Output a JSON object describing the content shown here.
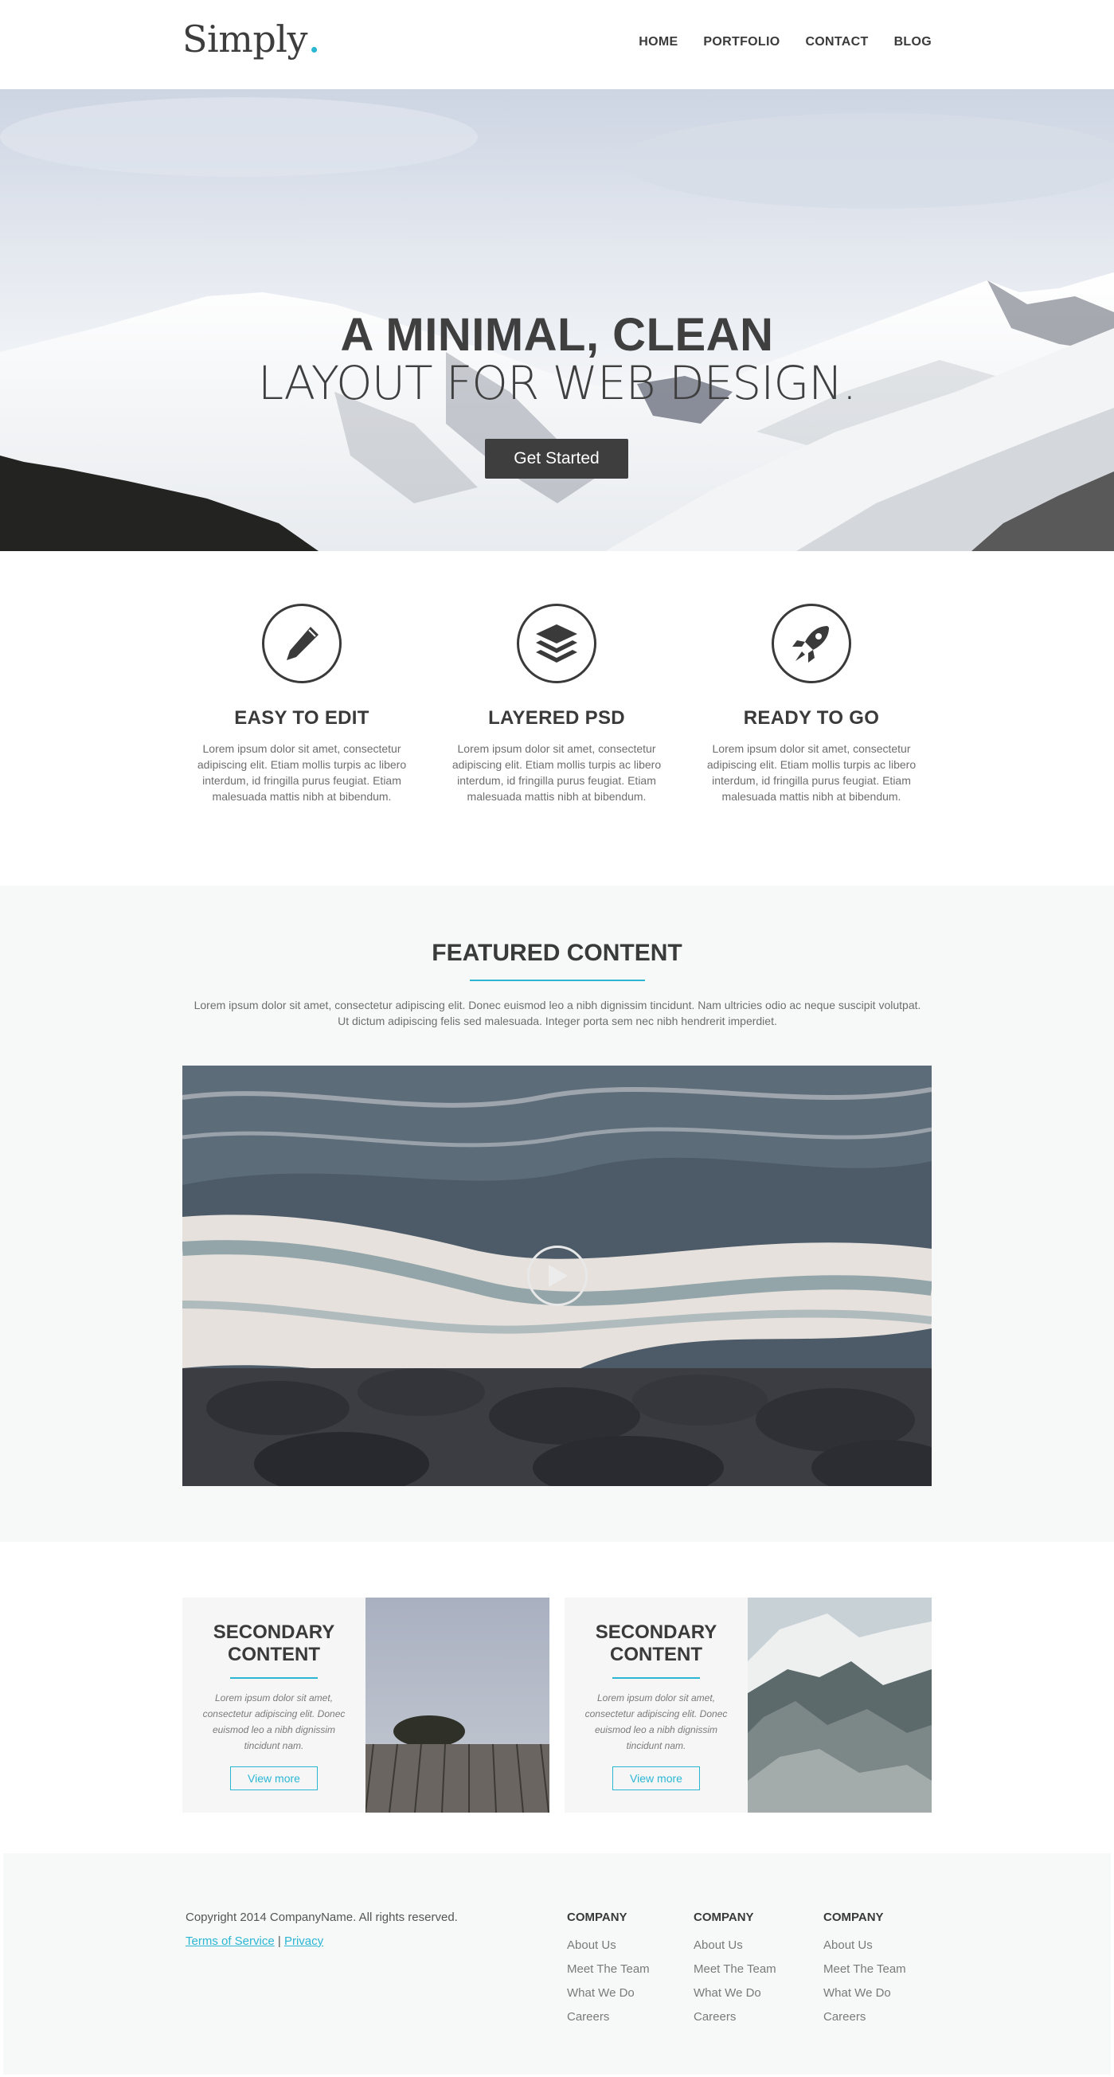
{
  "header": {
    "logo": "Simply",
    "logo_dot": ".",
    "nav": [
      "HOME",
      "PORTFOLIO",
      "CONTACT",
      "BLOG"
    ]
  },
  "hero": {
    "title": "A MINIMAL, CLEAN",
    "subtitle": "LAYOUT FOR WEB DESIGN.",
    "button": "Get Started"
  },
  "features": [
    {
      "icon": "pencil-icon",
      "title": "EASY TO EDIT",
      "text": "Lorem ipsum dolor sit amet, consectetur adipiscing elit. Etiam mollis turpis ac libero interdum, id fringilla purus feugiat. Etiam malesuada mattis nibh at bibendum."
    },
    {
      "icon": "layers-icon",
      "title": "LAYERED PSD",
      "text": "Lorem ipsum dolor sit amet, consectetur adipiscing elit. Etiam mollis turpis ac libero interdum, id fringilla purus feugiat. Etiam malesuada mattis nibh at bibendum."
    },
    {
      "icon": "rocket-icon",
      "title": "READY TO GO",
      "text": "Lorem ipsum dolor sit amet, consectetur adipiscing elit. Etiam mollis turpis ac libero interdum, id fringilla purus feugiat. Etiam malesuada mattis nibh at bibendum."
    }
  ],
  "featured": {
    "title": "FEATURED CONTENT",
    "text": "Lorem ipsum dolor sit amet, consectetur adipiscing elit. Donec euismod leo a nibh dignissim tincidunt. Nam ultricies odio ac neque suscipit volutpat. Ut dictum adipiscing felis sed malesuada. Integer porta sem nec nibh hendrerit imperdiet.",
    "video_icon": "play-icon"
  },
  "secondary": [
    {
      "title": "SECONDARY CONTENT",
      "text": "Lorem ipsum dolor sit amet, consectetur adipiscing elit. Donec euismod leo a nibh dignissim tincidunt nam.",
      "button": "View more"
    },
    {
      "title": "SECONDARY CONTENT",
      "text": "Lorem ipsum dolor sit amet, consectetur adipiscing elit. Donec euismod leo a nibh dignissim tincidunt nam.",
      "button": "View more"
    }
  ],
  "footer": {
    "copyright": "Copyright 2014 CompanyName. All rights reserved.",
    "terms": "Terms of Service",
    "separator": "|",
    "privacy": "Privacy",
    "columns": [
      {
        "heading": "COMPANY",
        "links": [
          "About Us",
          "Meet The Team",
          "What We Do",
          "Careers"
        ]
      },
      {
        "heading": "COMPANY",
        "links": [
          "About Us",
          "Meet The Team",
          "What We Do",
          "Careers"
        ]
      },
      {
        "heading": "COMPANY",
        "links": [
          "About Us",
          "Meet The Team",
          "What We Do",
          "Careers"
        ]
      }
    ]
  },
  "colors": {
    "accent": "#2bb6d3",
    "text_dark": "#3a3a3a",
    "button_dark": "#3e3e3e",
    "section_bg": "#f7f8f8"
  }
}
